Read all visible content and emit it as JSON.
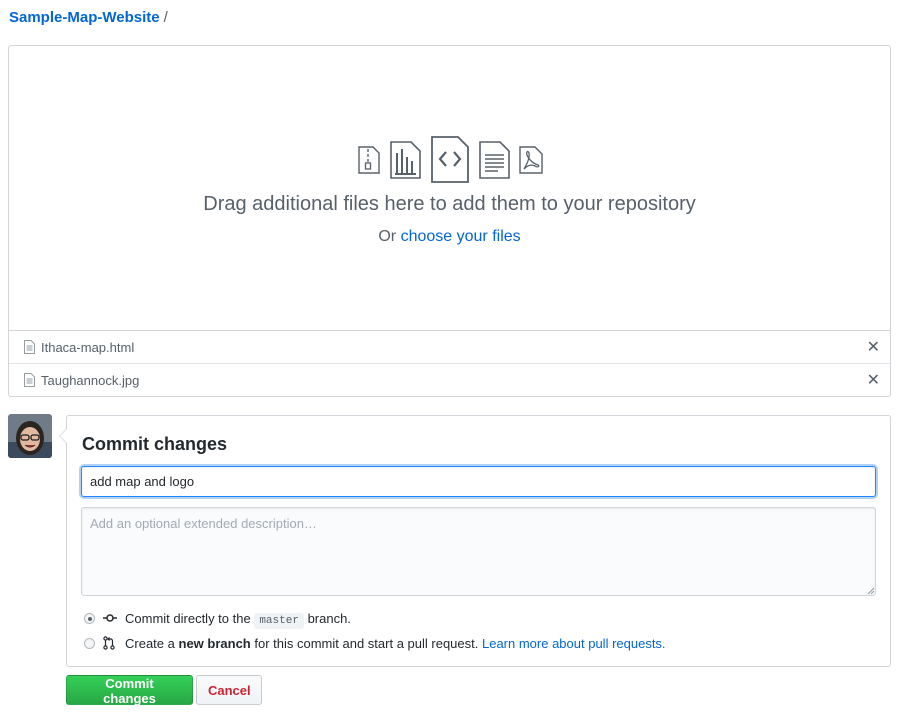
{
  "breadcrumb": {
    "repo": "Sample-Map-Website",
    "separator": "/"
  },
  "dropzone": {
    "icons": [
      "zip-file-icon",
      "chart-file-icon",
      "code-file-icon",
      "text-file-icon",
      "pdf-file-icon"
    ],
    "message": "Drag additional files here to add them to your repository",
    "or_text": "Or",
    "choose_link": "choose your files"
  },
  "files": [
    {
      "name": "Ithaca-map.html",
      "icon": "file-icon",
      "remove_icon": "close-icon"
    },
    {
      "name": "Taughannock.jpg",
      "icon": "file-icon",
      "remove_icon": "close-icon"
    }
  ],
  "commit": {
    "title": "Commit changes",
    "summary_value": "add map and logo",
    "description_placeholder": "Add an optional extended description…",
    "option_direct": {
      "prefix": "Commit directly to the",
      "branch": "master",
      "suffix": "branch.",
      "selected": true,
      "icon": "git-commit-icon"
    },
    "option_new_branch": {
      "prefix": "Create a",
      "bold": "new branch",
      "middle": "for this commit and start a pull request.",
      "link": "Learn more about pull requests.",
      "selected": false,
      "icon": "git-pull-request-icon"
    }
  },
  "buttons": {
    "commit": "Commit changes",
    "cancel": "Cancel"
  },
  "colors": {
    "link": "#0366d6",
    "primary": "#28a745",
    "danger": "#cb2431",
    "border": "#d1d5da",
    "text_muted": "#586069"
  }
}
